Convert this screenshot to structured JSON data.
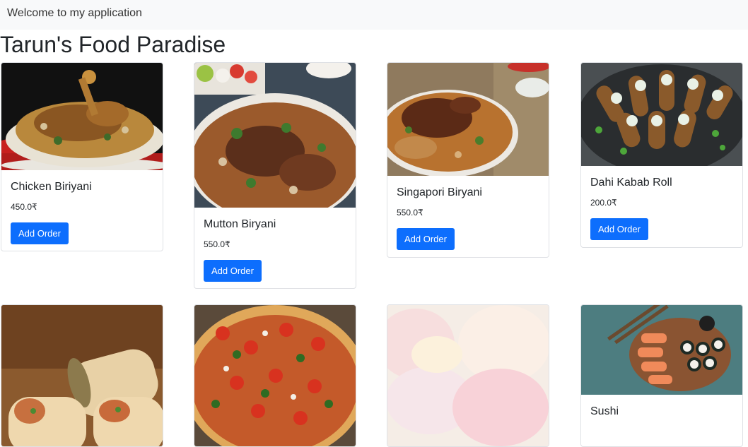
{
  "navbar": {
    "text": "Welcome to my application"
  },
  "page": {
    "title": "Tarun's Food Paradise"
  },
  "cards": [
    {
      "title": "Chicken Biriyani",
      "price": "450.0₹",
      "button": "Add Order"
    },
    {
      "title": "Mutton Biryani",
      "price": "550.0₹",
      "button": "Add Order"
    },
    {
      "title": "Singapori Biryani",
      "price": "550.0₹",
      "button": "Add Order"
    },
    {
      "title": "Dahi Kabab Roll",
      "price": "200.0₹",
      "button": "Add Order"
    },
    {
      "title": "",
      "price": "",
      "button": ""
    },
    {
      "title": "",
      "price": "",
      "button": ""
    },
    {
      "title": "",
      "price": "",
      "button": ""
    },
    {
      "title": "Sushi",
      "price": "",
      "button": ""
    }
  ],
  "colors": {
    "primary": "#0d6efd",
    "navbar_bg": "#f8f9fa"
  },
  "icons": [
    "chicken-biriyani-image",
    "mutton-biryani-image",
    "singapori-biryani-image",
    "dahi-kabab-roll-image",
    "wrap-image",
    "pizza-image",
    "mochi-image",
    "sushi-image"
  ]
}
